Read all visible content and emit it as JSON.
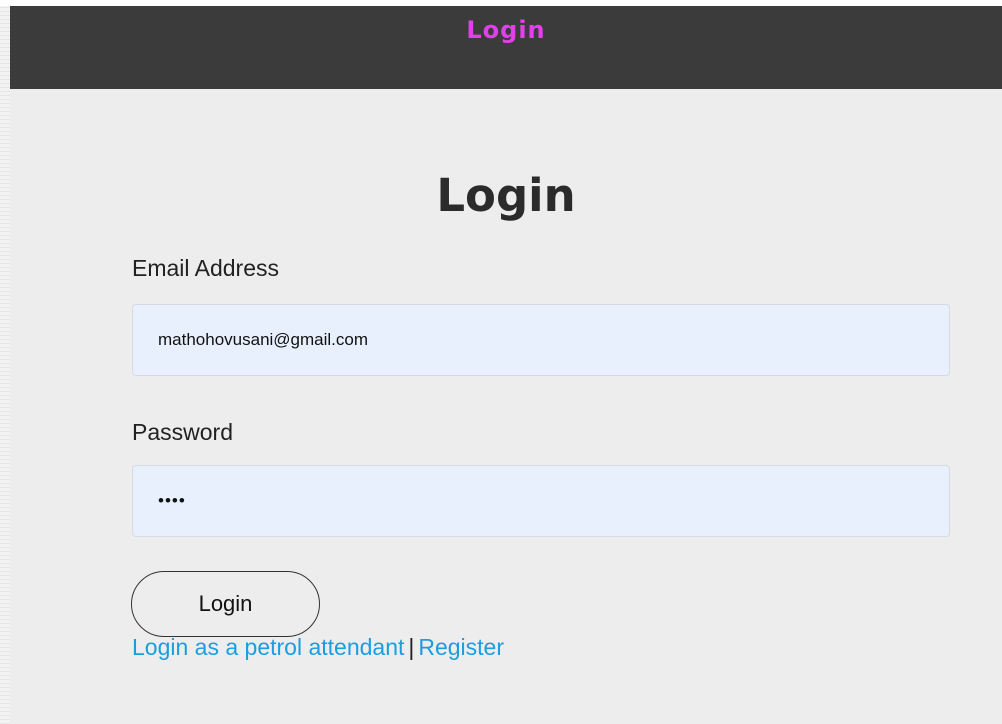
{
  "navbar": {
    "title": "Login"
  },
  "form": {
    "heading": "Login",
    "email_label": "Email Address",
    "email_value": "mathohovusani@gmail.com",
    "password_label": "Password",
    "password_value": "••••",
    "submit_label": "Login"
  },
  "links": {
    "attendant_label": "Login as a petrol attendant",
    "separator": "|",
    "register_label": "Register"
  },
  "colors": {
    "navbar_bg": "#3b3b3b",
    "navbar_title": "#e040e8",
    "link": "#1a9ee0",
    "input_bg": "#e8f0fe",
    "page_bg": "#ededed"
  }
}
